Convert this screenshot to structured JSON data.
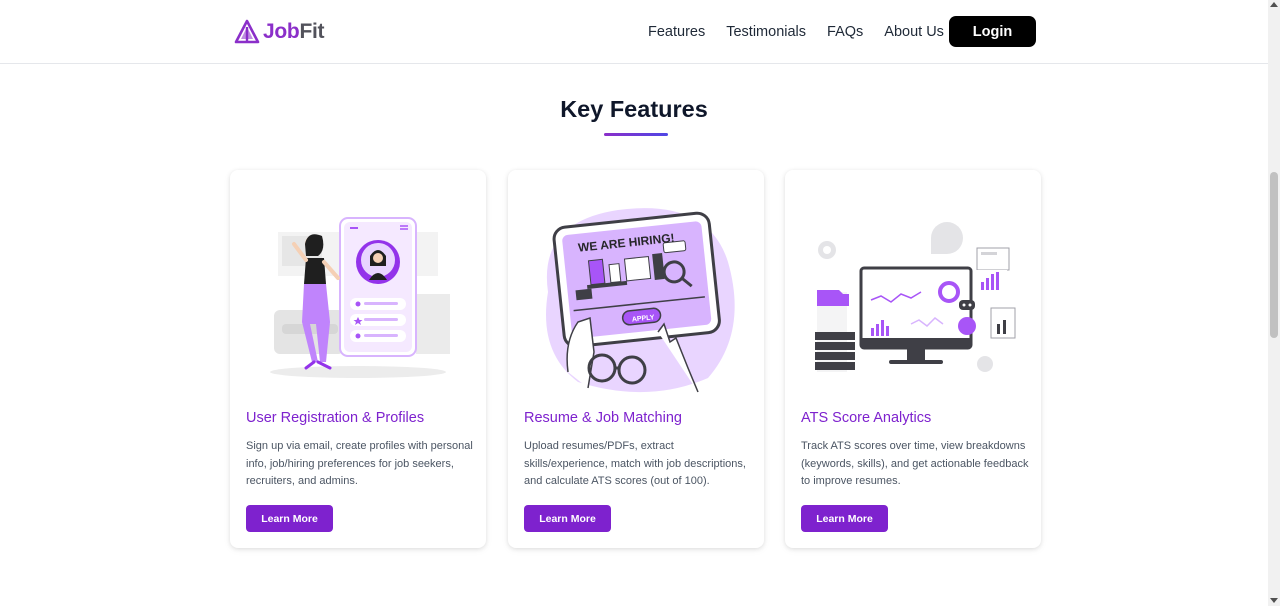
{
  "brand": {
    "name_part1": "Job",
    "name_part2": "Fit",
    "accent": "#8b2fc9"
  },
  "nav": {
    "links": [
      "Features",
      "Testimonials",
      "FAQs",
      "About Us"
    ],
    "login_label": "Login"
  },
  "section": {
    "title": "Key Features"
  },
  "cards": [
    {
      "title": "User Registration & Profiles",
      "description": "Sign up via email, create profiles with personal info, job/hiring preferences for job seekers, recruiters, and admins.",
      "button": "Learn More",
      "illustration": "woman-phone-profile-illustration"
    },
    {
      "title": "Resume & Job Matching",
      "description": "Upload resumes/PDFs, extract skills/experience, match with job descriptions, and calculate ATS scores (out of 100).",
      "button": "Learn More",
      "illustration": "hiring-tablet-illustration",
      "illustration_text": {
        "heading": "WE ARE HIRING!",
        "button": "APPLY"
      }
    },
    {
      "title": "ATS Score Analytics",
      "description": "Track ATS scores over time, view breakdowns (keywords, skills), and get actionable feedback to improve resumes.",
      "button": "Learn More",
      "illustration": "analytics-dashboard-illustration"
    }
  ],
  "colors": {
    "primary": "#7e22ce",
    "dark": "#0f172a",
    "button_dark": "#000000"
  }
}
